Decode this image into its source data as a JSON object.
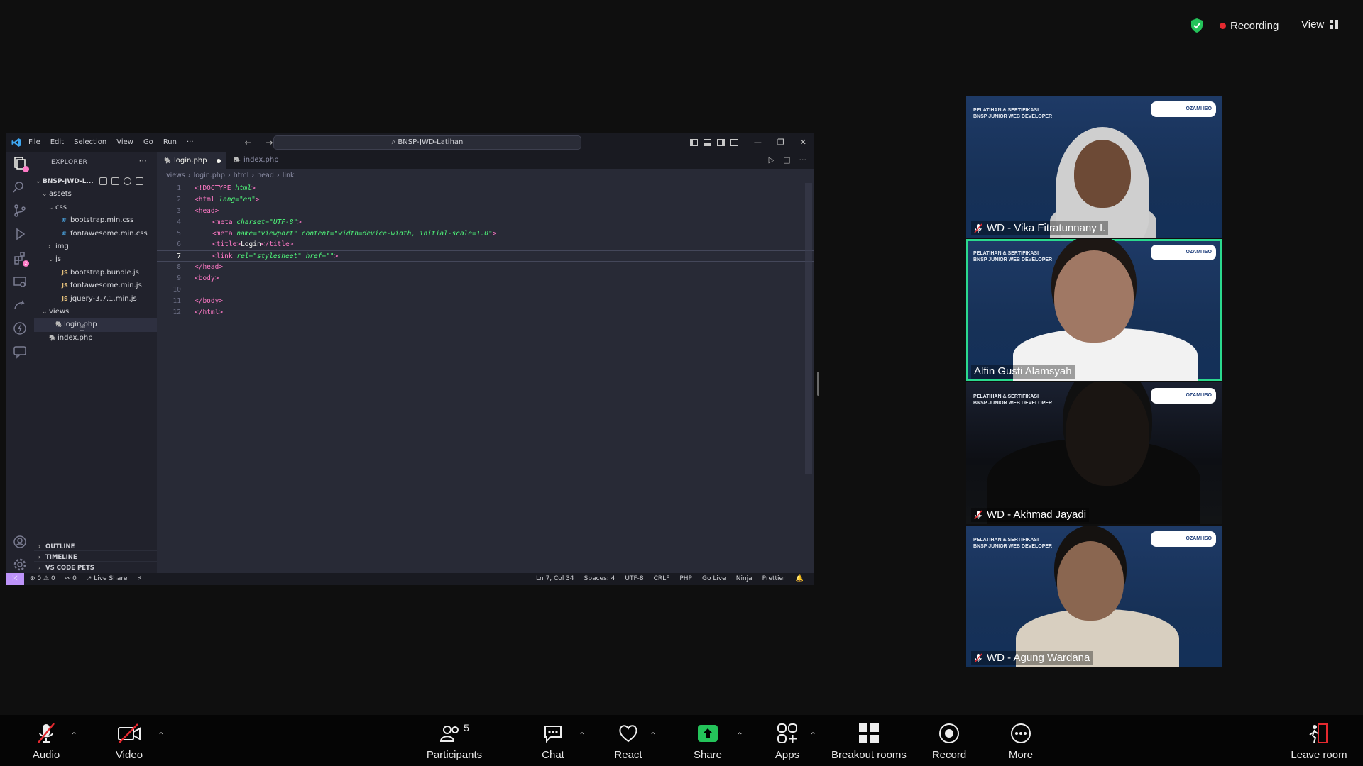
{
  "meeting": {
    "recording_label": "Recording",
    "view_label": "View"
  },
  "vscode": {
    "menu": [
      "File",
      "Edit",
      "Selection",
      "View",
      "Go",
      "Run",
      "···"
    ],
    "command_center": "BNSP-JWD-Latihan",
    "explorer_title": "EXPLORER",
    "explorer_more": "···",
    "root_folder": "BNSP-JWD-L...",
    "tree": [
      {
        "label": "assets",
        "depth": 1,
        "type": "folder",
        "open": true
      },
      {
        "label": "css",
        "depth": 2,
        "type": "folder",
        "open": true
      },
      {
        "label": "bootstrap.min.css",
        "depth": 3,
        "type": "css"
      },
      {
        "label": "fontawesome.min.css",
        "depth": 3,
        "type": "css"
      },
      {
        "label": "img",
        "depth": 2,
        "type": "folder",
        "open": false
      },
      {
        "label": "js",
        "depth": 2,
        "type": "folder",
        "open": true
      },
      {
        "label": "bootstrap.bundle.js",
        "depth": 3,
        "type": "js"
      },
      {
        "label": "fontawesome.min.js",
        "depth": 3,
        "type": "js"
      },
      {
        "label": "jquery-3.7.1.min.js",
        "depth": 3,
        "type": "js"
      },
      {
        "label": "views",
        "depth": 1,
        "type": "folder",
        "open": true
      },
      {
        "label": "login.php",
        "depth": 2,
        "type": "php",
        "selected": true
      },
      {
        "label": "index.php",
        "depth": 1,
        "type": "php"
      }
    ],
    "panels": [
      "OUTLINE",
      "TIMELINE",
      "VS CODE PETS"
    ],
    "tabs": [
      {
        "label": "login.php",
        "active": true,
        "modified": true
      },
      {
        "label": "index.php",
        "active": false
      }
    ],
    "breadcrumb": [
      "views",
      "login.php",
      "html",
      "head",
      "link"
    ],
    "code_lines": [
      "<!DOCTYPE html>",
      "<html lang=\"en\">",
      "<head>",
      "    <meta charset=\"UTF-8\">",
      "    <meta name=\"viewport\" content=\"width=device-width, initial-scale=1.0\">",
      "    <title>Login</title>",
      "    <link rel=\"stylesheet\" href=\"\">",
      "</head>",
      "<body>",
      "",
      "</body>",
      "</html>"
    ],
    "current_line": 7,
    "status_left": {
      "errors": "0",
      "warnings": "0",
      "ports": "0",
      "live_share": "Live Share"
    },
    "status_right": [
      "Ln 7, Col 34",
      "Spaces: 4",
      "UTF-8",
      "CRLF",
      "PHP",
      "Go Live",
      "Ninja",
      "Prettier"
    ]
  },
  "participants": [
    {
      "name": "WD - Vika Fitratunnany I.",
      "muted": true,
      "speaking": false
    },
    {
      "name": "Alfin Gusti Alamsyah",
      "muted": false,
      "speaking": true
    },
    {
      "name": "WD - Akhmad Jayadi",
      "muted": true,
      "speaking": false
    },
    {
      "name": "WD - Agung Wardana",
      "muted": true,
      "speaking": false
    }
  ],
  "tile_banner": {
    "line1": "PELATIHAN & SERTIFIKASI",
    "line2": "BNSP JUNIOR WEB DEVELOPER",
    "logo_text": "OZAMI ISO"
  },
  "toolbar": {
    "audio": "Audio",
    "video": "Video",
    "participants": "Participants",
    "participant_count": "5",
    "chat": "Chat",
    "react": "React",
    "share": "Share",
    "apps": "Apps",
    "breakout": "Breakout rooms",
    "record": "Record",
    "more": "More",
    "leave": "Leave room"
  },
  "colors": {
    "vscode_accent": "#bd93f9",
    "speaker_border": "#2bd98e",
    "share_green": "#24c35a",
    "recording_red": "#e5292f"
  }
}
